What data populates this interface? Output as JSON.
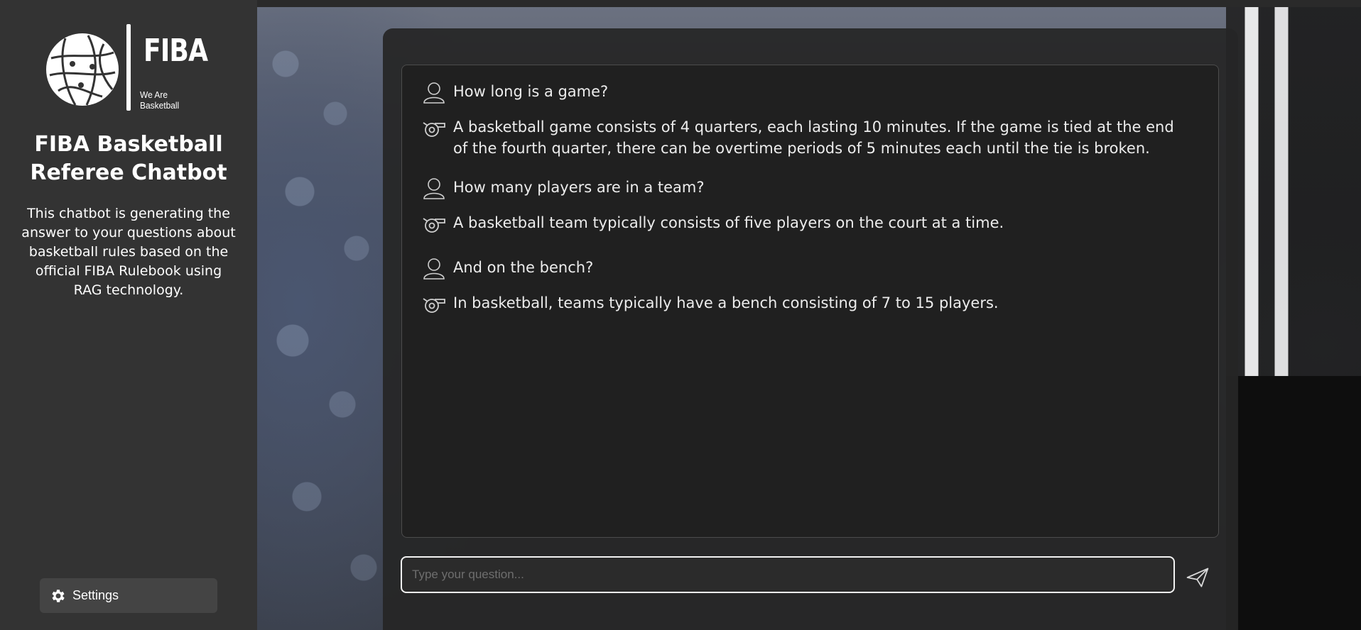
{
  "sidebar": {
    "logo_text": "FIBA",
    "logo_tagline": "We Are Basketball",
    "title": "FIBA Basketball Referee Chatbot",
    "description": "This chatbot is generating the answer to your questions about basketball rules based on the official FIBA Rulebook using RAG technology.",
    "settings_label": "Settings",
    "settings_icon": "gear-icon"
  },
  "chat": {
    "messages": [
      {
        "role": "user",
        "icon": "user-icon",
        "text": "How long is a game?"
      },
      {
        "role": "assistant",
        "icon": "whistle-icon",
        "text": "A basketball game consists of 4 quarters, each lasting 10 minutes. If the game is tied at the end of the fourth quarter, there can be overtime periods of 5 minutes each until the tie is broken."
      },
      {
        "role": "user",
        "icon": "user-icon",
        "text": "How many players are in a team?"
      },
      {
        "role": "assistant",
        "icon": "whistle-icon",
        "text": "A basketball team typically consists of five players on the court at a time."
      },
      {
        "role": "user",
        "icon": "user-icon",
        "text": "And on the bench?"
      },
      {
        "role": "assistant",
        "icon": "whistle-icon",
        "text": "In basketball, teams typically have a bench consisting of 7 to 15 players."
      }
    ]
  },
  "input": {
    "placeholder": "Type your question...",
    "value": "",
    "send_icon": "paper-plane-icon"
  },
  "colors": {
    "sidebar_bg": "#333333",
    "chat_panel_bg": "#262626",
    "text": "#ececec"
  }
}
